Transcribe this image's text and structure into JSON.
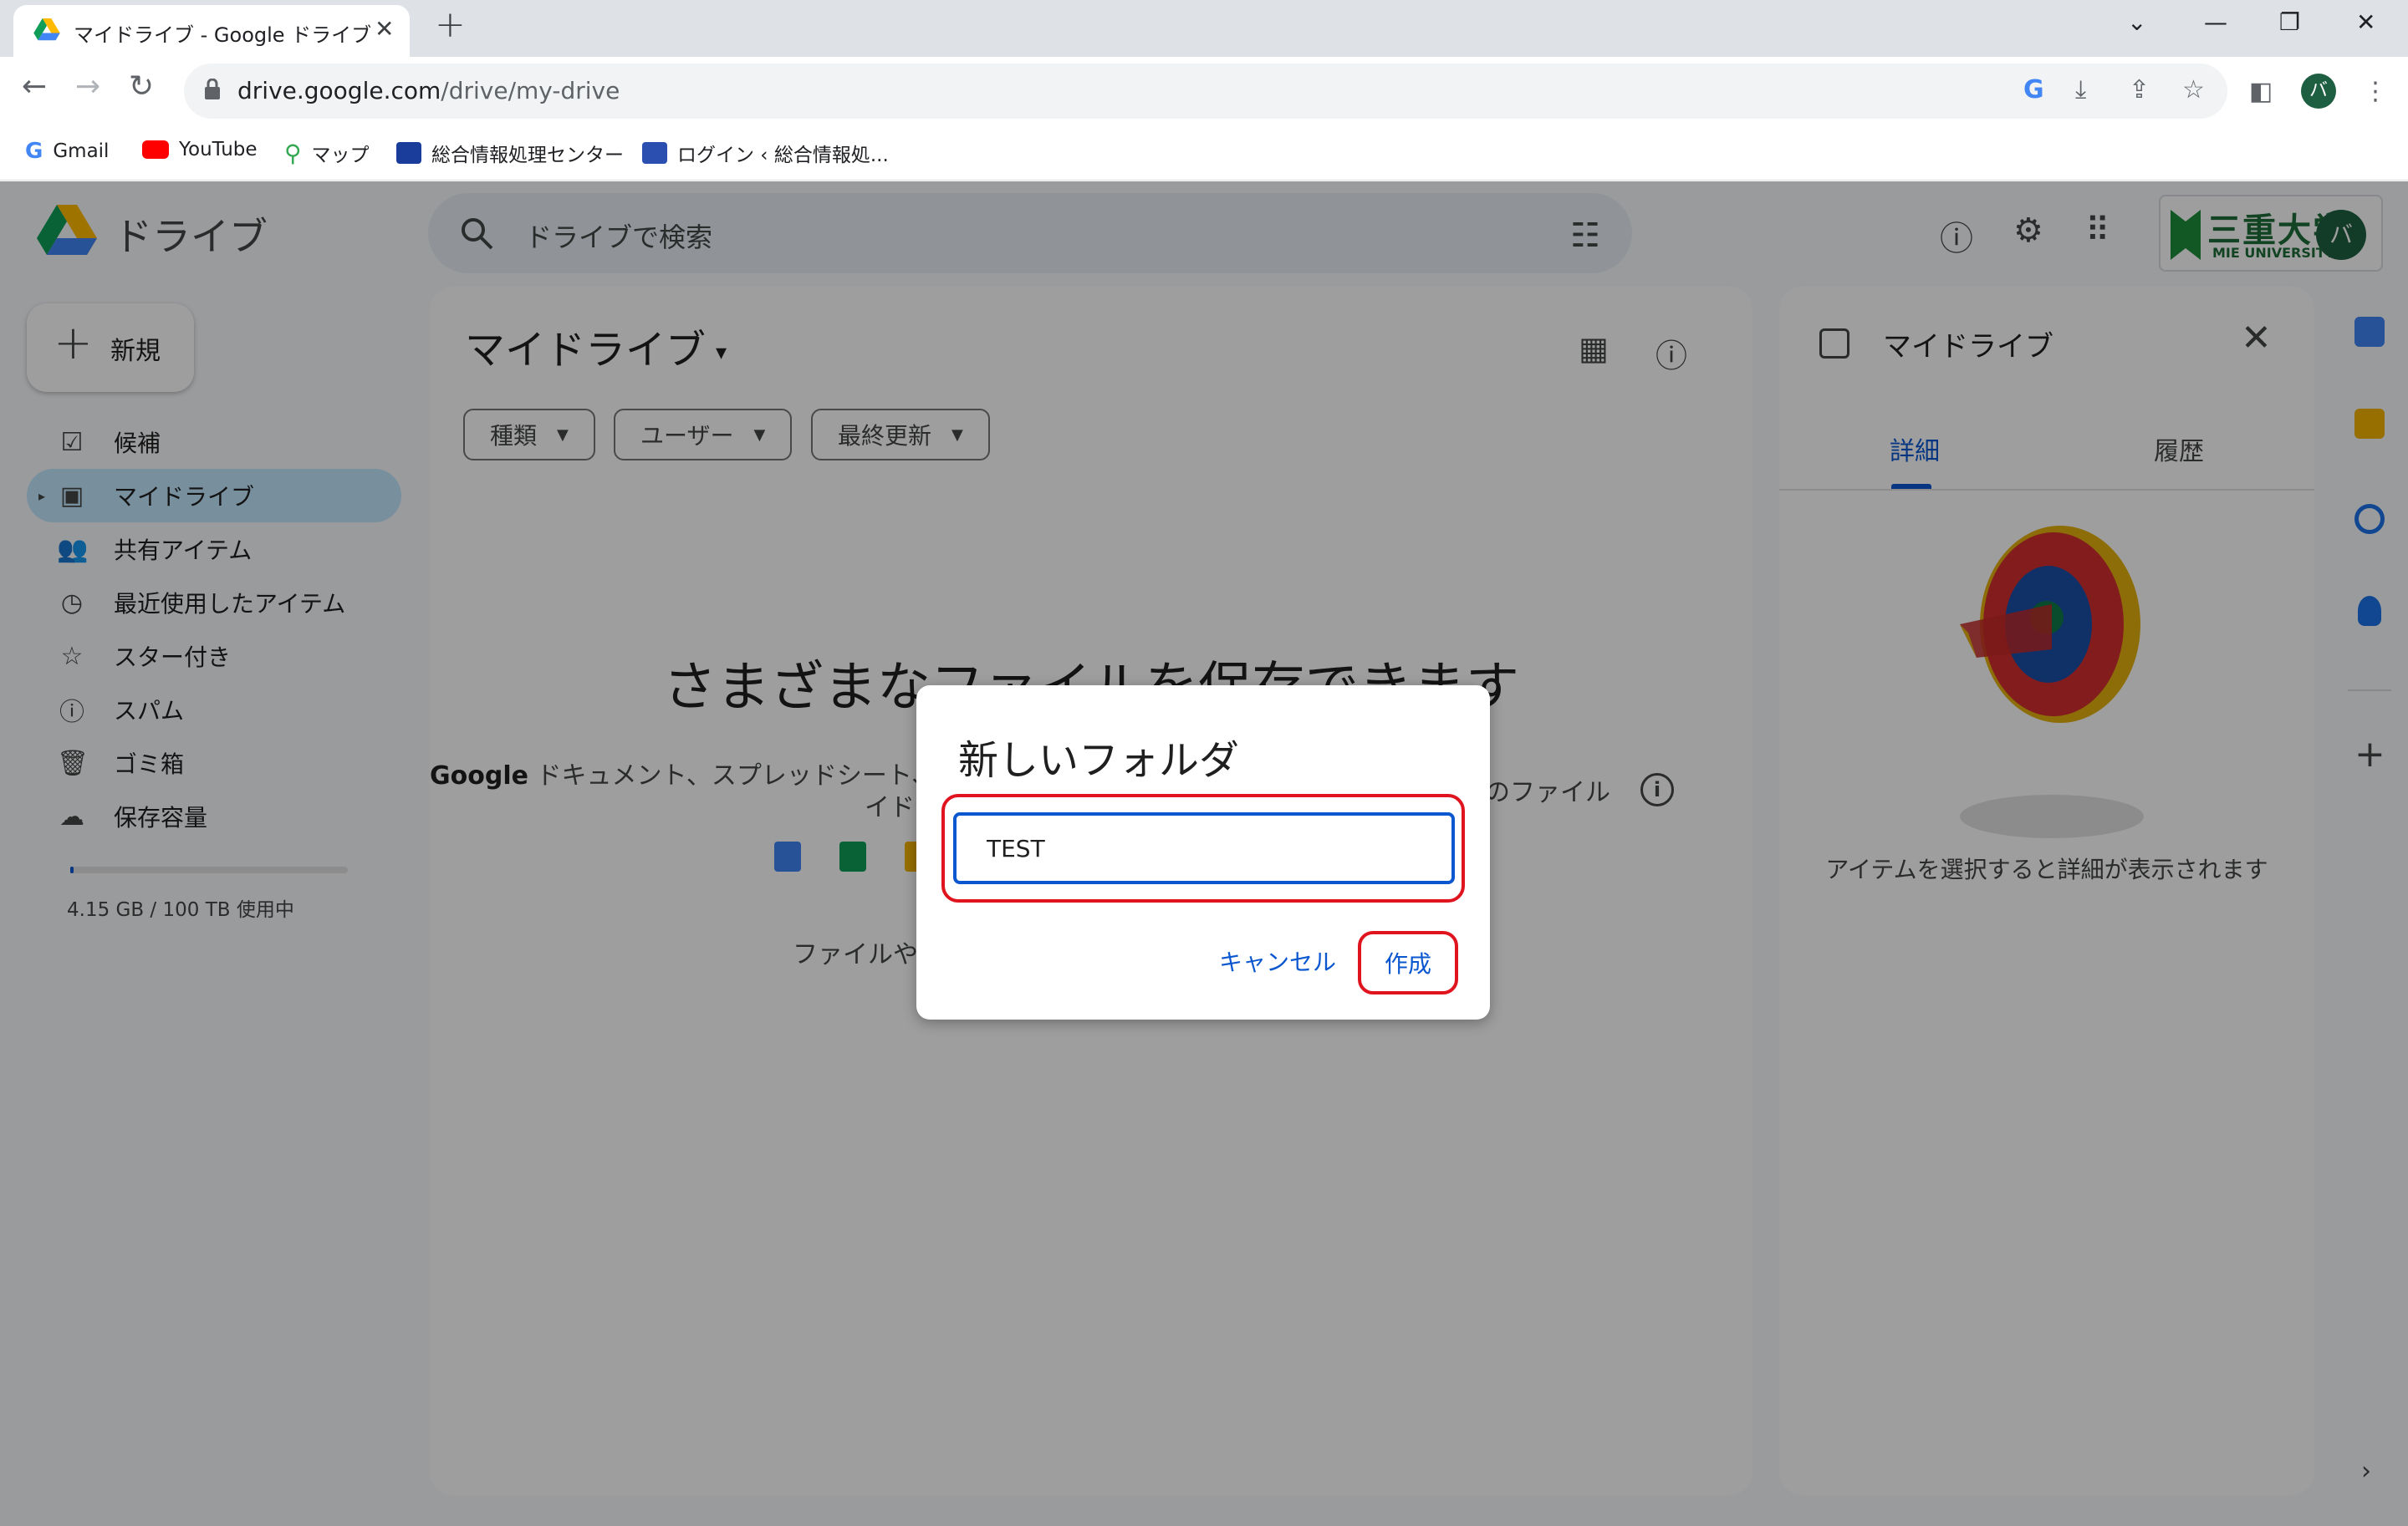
{
  "browser": {
    "tab_title": "マイドライブ - Google ドライブ",
    "url_host": "drive.google.com",
    "url_path": "/drive/my-drive",
    "profile_initial": "バ",
    "bookmarks": [
      "Gmail",
      "YouTube",
      "マップ",
      "総合情報処理センター",
      "ログイン ‹ 総合情報処..."
    ]
  },
  "app": {
    "name": "ドライブ",
    "search_placeholder": "ドライブで検索",
    "org_name": "三重大学",
    "org_sub": "MIE UNIVERSITY",
    "avatar_initial": "バ"
  },
  "sidebar": {
    "new_label": "新規",
    "items": [
      {
        "label": "候補"
      },
      {
        "label": "マイドライブ"
      },
      {
        "label": "共有アイテム"
      },
      {
        "label": "最近使用したアイテム"
      },
      {
        "label": "スター付き"
      },
      {
        "label": "スパム"
      },
      {
        "label": "ゴミ箱"
      },
      {
        "label": "保存容量"
      }
    ],
    "storage_text": "4.15 GB / 100 TB 使用中",
    "storage_fraction": 4.15e-05
  },
  "main": {
    "title": "マイドライブ",
    "filters": [
      "種類",
      "ユーザー",
      "最終更新"
    ],
    "empty_title": "さまざまなファイルを保存できます",
    "empty_desc_a": "Google",
    "empty_desc_b": " ドキュメント、スプレッドシート、ス",
    "empty_desc_c": "タのファイル",
    "empty_desc_d": "イド",
    "empty_upload": "ファイルやフ"
  },
  "details": {
    "title": "マイドライブ",
    "tabs": [
      "詳細",
      "履歴"
    ],
    "message": "アイテムを選択すると詳細が表示されます"
  },
  "dialog": {
    "title": "新しいフォルダ",
    "input_value": "TEST",
    "cancel_label": "キャンセル",
    "create_label": "作成"
  },
  "colors": {
    "accent": "#0b57d0",
    "highlight": "#e0141e",
    "active_nav": "#c2e7ff"
  }
}
